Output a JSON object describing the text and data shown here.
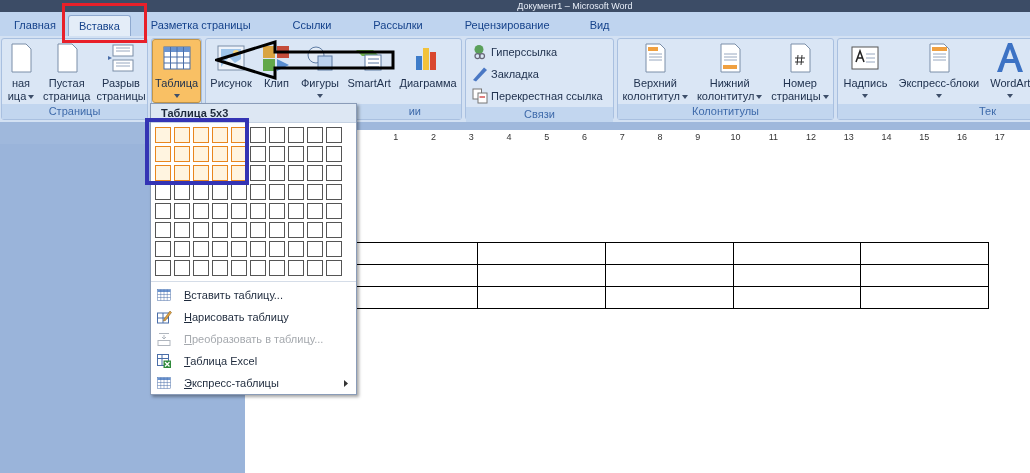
{
  "window": {
    "title": "Документ1 – Microsoft Word"
  },
  "tabs": [
    {
      "label": "Главная",
      "selected": false
    },
    {
      "label": "Вставка",
      "selected": true
    },
    {
      "label": "Разметка страницы",
      "selected": false
    },
    {
      "label": "Ссылки",
      "selected": false
    },
    {
      "label": "Рассылки",
      "selected": false
    },
    {
      "label": "Рецензирование",
      "selected": false
    },
    {
      "label": "Вид",
      "selected": false
    }
  ],
  "ribbon": {
    "groups": [
      {
        "label": "Страницы",
        "label_cut": false,
        "buttons": [
          {
            "kind": "large",
            "lines": [
              "ная",
              "ица"
            ],
            "dropdown": true,
            "pressed": false
          },
          {
            "kind": "large",
            "lines": [
              "Пустая",
              "страница"
            ],
            "dropdown": false,
            "pressed": false
          },
          {
            "kind": "large",
            "lines": [
              "Разрыв",
              "страницы"
            ],
            "dropdown": false,
            "pressed": false
          }
        ]
      },
      {
        "label_cut": false,
        "buttons": [
          {
            "kind": "large",
            "lines": [
              "Таблица"
            ],
            "dropdown": true,
            "pressed": true
          }
        ]
      },
      {
        "label": "ии",
        "label_cut": true,
        "buttons": [
          {
            "kind": "large",
            "lines": [
              "Рисунок"
            ],
            "dropdown": false,
            "pressed": false
          },
          {
            "kind": "large",
            "lines": [
              "Клип"
            ],
            "dropdown": false,
            "pressed": false
          },
          {
            "kind": "large",
            "lines": [
              "Фигуры"
            ],
            "dropdown": true,
            "pressed": false
          },
          {
            "kind": "large",
            "lines": [
              "SmartArt"
            ],
            "dropdown": false,
            "pressed": false
          },
          {
            "kind": "large",
            "lines": [
              "Диаграмма"
            ],
            "dropdown": false,
            "pressed": false
          }
        ]
      },
      {
        "label": "Связи",
        "label_cut": false,
        "buttons": [
          {
            "kind": "small",
            "lines": [
              "Гиперссылка"
            ]
          },
          {
            "kind": "small",
            "lines": [
              "Закладка"
            ]
          },
          {
            "kind": "small",
            "lines": [
              "Перекрестная ссылка"
            ]
          }
        ]
      },
      {
        "label": "Колонтитулы",
        "label_cut": false,
        "buttons": [
          {
            "kind": "large",
            "lines": [
              "Верхний",
              "колонтитул"
            ],
            "dropdown": true,
            "pressed": false
          },
          {
            "kind": "large",
            "lines": [
              "Нижний",
              "колонтитул"
            ],
            "dropdown": true,
            "pressed": false
          },
          {
            "kind": "large",
            "lines": [
              "Номер",
              "страницы"
            ],
            "dropdown": true,
            "pressed": false
          }
        ]
      },
      {
        "label": "Тек",
        "label_cut": true,
        "buttons": [
          {
            "kind": "large",
            "lines": [
              "Надпись"
            ],
            "dropdown": true,
            "pressed": false
          },
          {
            "kind": "large",
            "lines": [
              "Экспресс-блоки"
            ],
            "dropdown": true,
            "pressed": false
          },
          {
            "kind": "large",
            "lines": [
              "WordArt"
            ],
            "dropdown": true,
            "pressed": false
          }
        ]
      }
    ]
  },
  "ruler": [
    "1",
    "2",
    "3",
    "4",
    "5",
    "6",
    "7",
    "8",
    "9",
    "10",
    "11",
    "12",
    "13",
    "14",
    "15",
    "16",
    "17"
  ],
  "menu": {
    "header": "Таблица 5x3",
    "grid": [
      {
        "cells": [
          {
            "selected": true
          },
          {
            "selected": true
          },
          {
            "selected": true
          },
          {
            "selected": true
          },
          {
            "selected": true
          },
          {
            "selected": false
          },
          {
            "selected": false
          },
          {
            "selected": false
          },
          {
            "selected": false
          },
          {
            "selected": false
          }
        ]
      },
      {
        "cells": [
          {
            "selected": true
          },
          {
            "selected": true
          },
          {
            "selected": true
          },
          {
            "selected": true
          },
          {
            "selected": true
          },
          {
            "selected": false
          },
          {
            "selected": false
          },
          {
            "selected": false
          },
          {
            "selected": false
          },
          {
            "selected": false
          }
        ]
      },
      {
        "cells": [
          {
            "selected": true
          },
          {
            "selected": true
          },
          {
            "selected": true
          },
          {
            "selected": true
          },
          {
            "selected": true
          },
          {
            "selected": false
          },
          {
            "selected": false
          },
          {
            "selected": false
          },
          {
            "selected": false
          },
          {
            "selected": false
          }
        ]
      },
      {
        "cells": [
          {
            "selected": false
          },
          {
            "selected": false
          },
          {
            "selected": false
          },
          {
            "selected": false
          },
          {
            "selected": false
          },
          {
            "selected": false
          },
          {
            "selected": false
          },
          {
            "selected": false
          },
          {
            "selected": false
          },
          {
            "selected": false
          }
        ]
      },
      {
        "cells": [
          {
            "selected": false
          },
          {
            "selected": false
          },
          {
            "selected": false
          },
          {
            "selected": false
          },
          {
            "selected": false
          },
          {
            "selected": false
          },
          {
            "selected": false
          },
          {
            "selected": false
          },
          {
            "selected": false
          },
          {
            "selected": false
          }
        ]
      },
      {
        "cells": [
          {
            "selected": false
          },
          {
            "selected": false
          },
          {
            "selected": false
          },
          {
            "selected": false
          },
          {
            "selected": false
          },
          {
            "selected": false
          },
          {
            "selected": false
          },
          {
            "selected": false
          },
          {
            "selected": false
          },
          {
            "selected": false
          }
        ]
      },
      {
        "cells": [
          {
            "selected": false
          },
          {
            "selected": false
          },
          {
            "selected": false
          },
          {
            "selected": false
          },
          {
            "selected": false
          },
          {
            "selected": false
          },
          {
            "selected": false
          },
          {
            "selected": false
          },
          {
            "selected": false
          },
          {
            "selected": false
          }
        ]
      },
      {
        "cells": [
          {
            "selected": false
          },
          {
            "selected": false
          },
          {
            "selected": false
          },
          {
            "selected": false
          },
          {
            "selected": false
          },
          {
            "selected": false
          },
          {
            "selected": false
          },
          {
            "selected": false
          },
          {
            "selected": false
          },
          {
            "selected": false
          }
        ]
      }
    ],
    "items": [
      {
        "label": "Вставить таблицу...",
        "disabled": false,
        "submenu": false
      },
      {
        "label": "Нарисовать таблицу",
        "disabled": false,
        "submenu": false
      },
      {
        "label": "Преобразовать в таблицу...",
        "disabled": true,
        "submenu": false
      },
      {
        "label": "Таблица Excel",
        "disabled": false,
        "submenu": false
      },
      {
        "label": "Экспресс-таблицы",
        "disabled": false,
        "submenu": true
      }
    ]
  }
}
